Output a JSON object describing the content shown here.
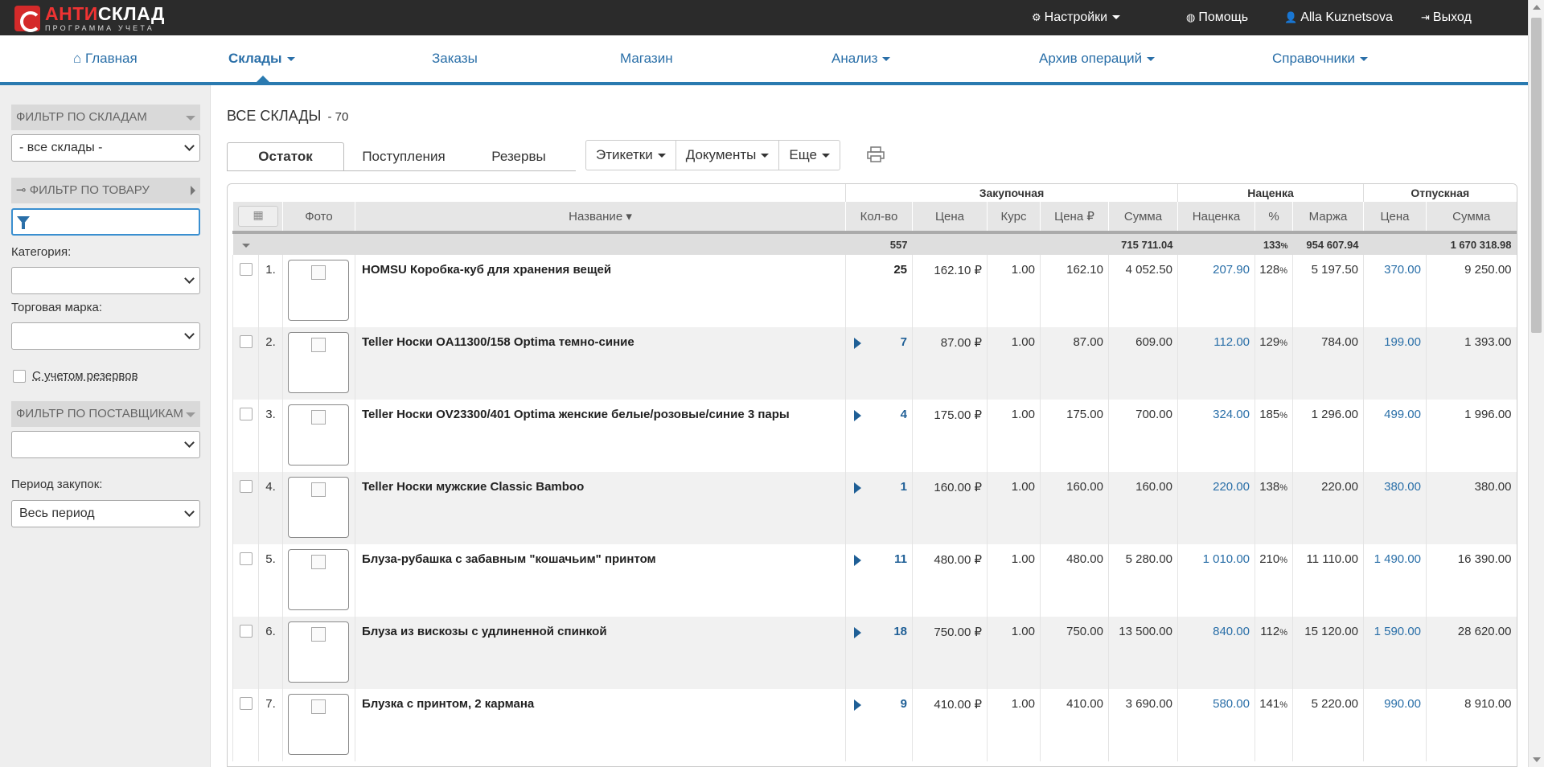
{
  "topbar": {
    "logo_main_red": "АНТИ",
    "logo_main_white": "СКЛАД",
    "logo_sub": "ПРОГРАММА УЧЕТА",
    "settings": "Настройки",
    "help": "Помощь",
    "user": "Alla Kuznetsova",
    "logout": "Выход"
  },
  "nav": {
    "home": "Главная",
    "warehouses": "Склады",
    "orders": "Заказы",
    "shop": "Магазин",
    "analysis": "Анализ",
    "archive": "Архив операций",
    "references": "Справочники"
  },
  "sidebar": {
    "warehouse_filter_title": "ФИЛЬТР ПО СКЛАДАМ",
    "warehouse_select": "- все склады -",
    "product_filter_title": "ФИЛЬТР ПО ТОВАРУ",
    "product_search_value": "",
    "category_label": "Категория:",
    "category_value": "",
    "brand_label": "Торговая марка:",
    "brand_value": "",
    "reserves_label": "С учетом резервов",
    "supplier_filter_title": "ФИЛЬТР ПО ПОСТАВЩИКАМ",
    "supplier_value": "",
    "period_label": "Период закупок:",
    "period_value": "Весь период"
  },
  "content": {
    "title": "ВСЕ СКЛАДЫ",
    "count": "- 70",
    "tabs": [
      "Остаток",
      "Поступления",
      "Резервы"
    ],
    "buttons": [
      "Этикетки",
      "Документы",
      "Еще"
    ]
  },
  "table": {
    "groups": {
      "purchase": "Закупочная",
      "markup": "Наценка",
      "retail": "Отпускная"
    },
    "headers": [
      "Фото",
      "Название ▾",
      "Кол-во",
      "Цена",
      "Курс",
      "Цена ₽",
      "Сумма",
      "Наценка",
      "%",
      "Маржа",
      "Цена",
      "Сумма"
    ],
    "totals": {
      "qty": "557",
      "sum": "715 711.04",
      "pct": "133",
      "pct_sign": "%",
      "margin": "954 607.94",
      "retail_sum": "1 670 318.98"
    },
    "rows": [
      {
        "n": "1.",
        "name": "HOMSU Коробка-куб для хранения вещей",
        "qty": "25",
        "expand": false,
        "price": "162.10 ₽",
        "rate": "1.00",
        "price_rub": "162.10",
        "sum": "4 052.50",
        "markup": "207.90",
        "pct": "128",
        "margin": "5 197.50",
        "retail_price": "370.00",
        "retail_sum": "9 250.00"
      },
      {
        "n": "2.",
        "name": "Teller Носки OA11300/158 Optima темно-синие",
        "qty": "7",
        "expand": true,
        "price": "87.00 ₽",
        "rate": "1.00",
        "price_rub": "87.00",
        "sum": "609.00",
        "markup": "112.00",
        "pct": "129",
        "margin": "784.00",
        "retail_price": "199.00",
        "retail_sum": "1 393.00"
      },
      {
        "n": "3.",
        "name": "Teller Носки OV23300/401 Optima женские белые/розовые/синие 3 пары",
        "qty": "4",
        "expand": true,
        "price": "175.00 ₽",
        "rate": "1.00",
        "price_rub": "175.00",
        "sum": "700.00",
        "markup": "324.00",
        "pct": "185",
        "margin": "1 296.00",
        "retail_price": "499.00",
        "retail_sum": "1 996.00"
      },
      {
        "n": "4.",
        "name": "Teller Носки мужские Classic Bamboo",
        "qty": "1",
        "expand": true,
        "price": "160.00 ₽",
        "rate": "1.00",
        "price_rub": "160.00",
        "sum": "160.00",
        "markup": "220.00",
        "pct": "138",
        "margin": "220.00",
        "retail_price": "380.00",
        "retail_sum": "380.00"
      },
      {
        "n": "5.",
        "name": "Блуза-рубашка с забавным \"кошачьим\" принтом",
        "qty": "11",
        "expand": true,
        "price": "480.00 ₽",
        "rate": "1.00",
        "price_rub": "480.00",
        "sum": "5 280.00",
        "markup": "1 010.00",
        "pct": "210",
        "margin": "11 110.00",
        "retail_price": "1 490.00",
        "retail_sum": "16 390.00"
      },
      {
        "n": "6.",
        "name": "Блуза из вискозы с удлиненной спинкой",
        "qty": "18",
        "expand": true,
        "price": "750.00 ₽",
        "rate": "1.00",
        "price_rub": "750.00",
        "sum": "13 500.00",
        "markup": "840.00",
        "pct": "112",
        "margin": "15 120.00",
        "retail_price": "1 590.00",
        "retail_sum": "28 620.00"
      },
      {
        "n": "7.",
        "name": "Блузка с принтом, 2 кармана",
        "qty": "9",
        "expand": true,
        "price": "410.00 ₽",
        "rate": "1.00",
        "price_rub": "410.00",
        "sum": "3 690.00",
        "markup": "580.00",
        "pct": "141",
        "margin": "5 220.00",
        "retail_price": "990.00",
        "retail_sum": "8 910.00"
      }
    ]
  },
  "colors": {
    "topbar": "#2b2b2b",
    "accent": "#2a7ab0",
    "link": "#2a6fa8",
    "logo_red": "#d42a2a"
  }
}
